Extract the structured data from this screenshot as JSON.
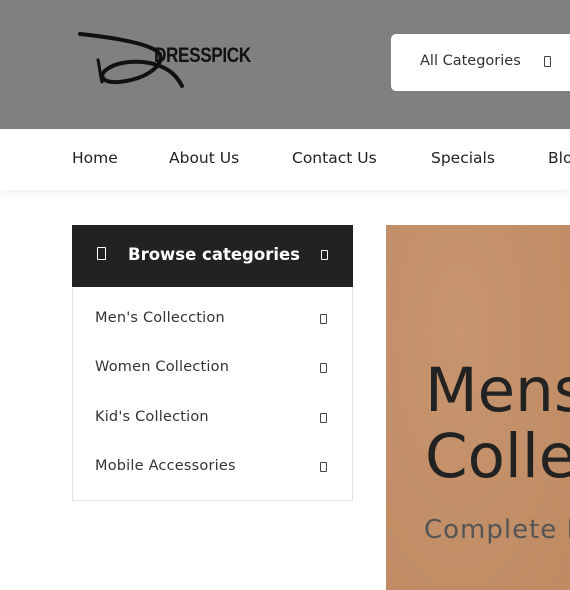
{
  "header": {
    "brand": "DRESSPICK",
    "category_select": {
      "value": "All Categories",
      "icon": "chevron-down-icon"
    }
  },
  "nav": {
    "items": [
      {
        "label": "Home"
      },
      {
        "label": "About Us"
      },
      {
        "label": "Contact Us"
      },
      {
        "label": "Specials"
      },
      {
        "label": "Blo"
      }
    ]
  },
  "sidebar": {
    "title": "Browse categories",
    "title_icon": "menu-icon",
    "toggle_icon": "chevron-down-icon",
    "items": [
      {
        "label": "Men's Collecction",
        "icon": "chevron-right-icon"
      },
      {
        "label": "Women Collection",
        "icon": "chevron-right-icon"
      },
      {
        "label": "Kid's Collection",
        "icon": "chevron-right-icon"
      },
      {
        "label": "Mobile Accessories",
        "icon": "chevron-right-icon"
      }
    ]
  },
  "banner": {
    "title_line1": "Mens",
    "title_line2": "Colle",
    "subtitle": "Complete R",
    "background_color": "#c48f66"
  },
  "colors": {
    "header_bg": "#808080",
    "sidebar_head_bg": "#222222",
    "text": "#222222"
  }
}
